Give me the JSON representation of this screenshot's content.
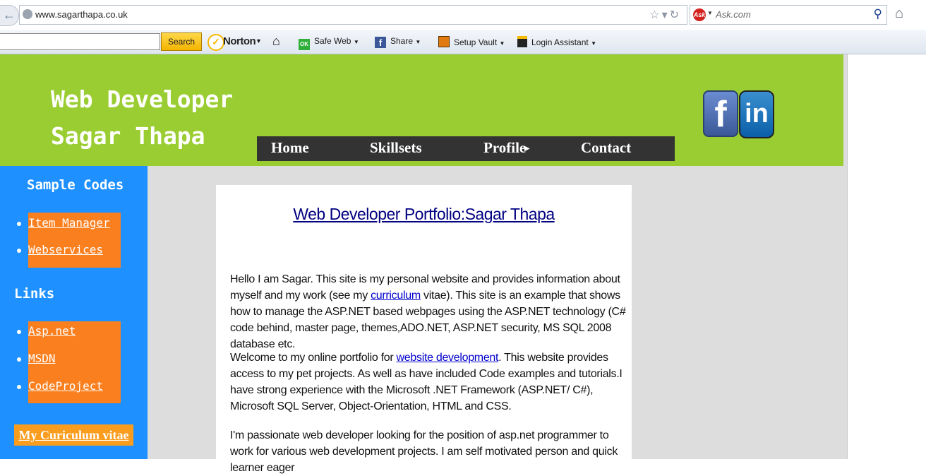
{
  "browser": {
    "url": "www.sagarthapa.co.uk",
    "search_engine_placeholder": "Ask.com",
    "ask_logo_text": "Ask"
  },
  "toolbar": {
    "search_label": "Search",
    "norton_label": "Norton",
    "items": [
      {
        "label": "Safe Web",
        "icon": "safe-web-icon"
      },
      {
        "label": "Share",
        "icon": "facebook-share-icon"
      },
      {
        "label": "Setup Vault",
        "icon": "vault-icon"
      },
      {
        "label": "Login Assistant",
        "icon": "login-assistant-icon"
      }
    ],
    "safe_web_badge": "OK"
  },
  "banner": {
    "title_line1": "Web Developer",
    "title_line2": "Sagar Thapa",
    "nav": [
      "Home",
      "Skillsets",
      "Profile",
      "Contact"
    ],
    "facebook_glyph": "f",
    "linkedin_glyph": "in"
  },
  "sidebar": {
    "heading_samples": "Sample Codes",
    "sample_links": [
      "Item Manager",
      "Webservices"
    ],
    "heading_links": "Links",
    "links": [
      "Asp.net",
      "MSDN",
      "CodeProject"
    ],
    "cv_button": "My Curiculum vitae"
  },
  "content": {
    "title": "Web Developer Portfolio:Sagar Thapa",
    "p1_before": "Hello I am Sagar. This site is my personal website and provides information about myself and my work (see my ",
    "p1_link": "curriculum",
    "p1_after": " vitae). This site is an example that shows how to manage the ASP.NET based webpages using the ASP.NET technology (C# code behind, master page, themes,ADO.NET, ASP.NET security, MS SQL 2008 database etc.",
    "p2_before": "Welcome to my online portfolio for ",
    "p2_link": "website development",
    "p2_after": ". This website provides access to my pet projects. As well as have included Code examples and tutorials.I have strong experience with the Microsoft .NET Framework (ASP.NET/ C#), Microsoft SQL Server, Object-Orientation, HTML and CSS.",
    "p3": "I'm passionate web developer looking for the position of asp.net programmer to work for various web development projects. I am self motivated person and quick learner eager"
  },
  "colors": {
    "banner": "#9acd32",
    "sidebar": "#1e90ff",
    "sidebar_box": "#fa7f1e",
    "navbar": "#333333",
    "title_link": "#000080"
  }
}
